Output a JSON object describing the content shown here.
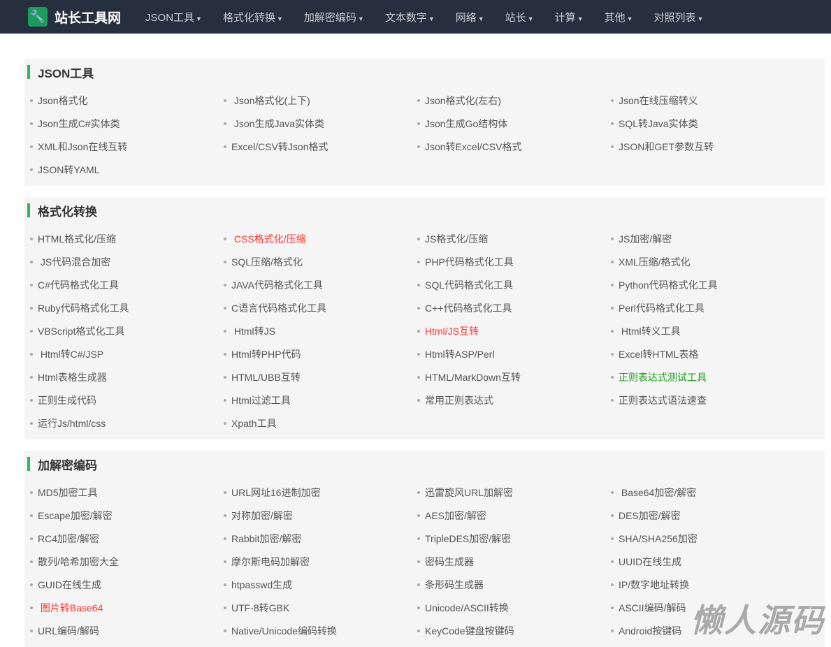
{
  "header": {
    "logo_icon": "wrench-icon",
    "title": "站长工具网",
    "menu": [
      "JSON工具",
      "格式化转换",
      "加解密编码",
      "文本数字",
      "网络",
      "站长",
      "计算",
      "其他",
      "对照列表"
    ]
  },
  "colors": {
    "nav": "#252f3e",
    "accent": "#2fb55c",
    "red": "#ff3333",
    "green": "#1a9d1a"
  },
  "sections": [
    {
      "title": "JSON工具",
      "items": [
        {
          "label": "Json格式化"
        },
        {
          "label": " Json格式化(上下)"
        },
        {
          "label": "Json格式化(左右)"
        },
        {
          "label": "Json在线压缩转义"
        },
        {
          "label": "Json生成C#实体类"
        },
        {
          "label": " Json生成Java实体类"
        },
        {
          "label": "Json生成Go结构体"
        },
        {
          "label": "SQL转Java实体类"
        },
        {
          "label": "XML和Json在线互转"
        },
        {
          "label": "Excel/CSV转Json格式"
        },
        {
          "label": "Json转Excel/CSV格式"
        },
        {
          "label": "JSON和GET参数互转"
        },
        {
          "label": "JSON转YAML"
        }
      ]
    },
    {
      "title": "格式化转换",
      "items": [
        {
          "label": "HTML格式化/压缩"
        },
        {
          "label": " CSS格式化/压缩",
          "style": "red"
        },
        {
          "label": "JS格式化/压缩"
        },
        {
          "label": "JS加密/解密"
        },
        {
          "label": " JS代码混合加密"
        },
        {
          "label": "SQL压缩/格式化"
        },
        {
          "label": "PHP代码格式化工具"
        },
        {
          "label": "XML压缩/格式化"
        },
        {
          "label": "C#代码格式化工具"
        },
        {
          "label": "JAVA代码格式化工具"
        },
        {
          "label": "SQL代码格式化工具"
        },
        {
          "label": "Python代码格式化工具"
        },
        {
          "label": "Ruby代码格式化工具"
        },
        {
          "label": "C语言代码格式化工具"
        },
        {
          "label": "C++代码格式化工具"
        },
        {
          "label": "Perl代码格式化工具"
        },
        {
          "label": "VBScript格式化工具"
        },
        {
          "label": " Html转JS"
        },
        {
          "label": "Html/JS互转",
          "style": "red"
        },
        {
          "label": " Html转义工具"
        },
        {
          "label": " Html转C#/JSP"
        },
        {
          "label": "Html转PHP代码"
        },
        {
          "label": "Html转ASP/Perl"
        },
        {
          "label": "Excel转HTML表格"
        },
        {
          "label": "Html表格生成器"
        },
        {
          "label": "HTML/UBB互转"
        },
        {
          "label": "HTML/MarkDown互转"
        },
        {
          "label": "正则表达式测试工具",
          "style": "green"
        },
        {
          "label": "正则生成代码"
        },
        {
          "label": "Html过滤工具"
        },
        {
          "label": "常用正则表达式"
        },
        {
          "label": "正则表达式语法速查"
        },
        {
          "label": "运行Js/html/css"
        },
        {
          "label": "Xpath工具"
        }
      ]
    },
    {
      "title": "加解密编码",
      "items": [
        {
          "label": "MD5加密工具"
        },
        {
          "label": "URL网址16进制加密"
        },
        {
          "label": "迅雷旋风URL加解密"
        },
        {
          "label": " Base64加密/解密"
        },
        {
          "label": "Escape加密/解密"
        },
        {
          "label": "对称加密/解密"
        },
        {
          "label": "AES加密/解密"
        },
        {
          "label": "DES加密/解密"
        },
        {
          "label": "RC4加密/解密"
        },
        {
          "label": "Rabbit加密/解密"
        },
        {
          "label": "TripleDES加密/解密"
        },
        {
          "label": "SHA/SHA256加密"
        },
        {
          "label": "散列/哈希加密大全"
        },
        {
          "label": "摩尔斯电码加解密"
        },
        {
          "label": "密码生成器"
        },
        {
          "label": "UUID在线生成"
        },
        {
          "label": "GUID在线生成"
        },
        {
          "label": "htpasswd生成"
        },
        {
          "label": "条形码生成器"
        },
        {
          "label": "IP/数字地址转换"
        },
        {
          "label": " 图片转Base64",
          "style": "red"
        },
        {
          "label": "UTF-8转GBK"
        },
        {
          "label": "Unicode/ASCII转换"
        },
        {
          "label": "ASCII编码/解码"
        },
        {
          "label": "URL编码/解码"
        },
        {
          "label": "Native/Unicode编码转换"
        },
        {
          "label": "KeyCode键盘按键码"
        },
        {
          "label": "Android按键码"
        }
      ]
    }
  ],
  "watermark": "懒人源码"
}
